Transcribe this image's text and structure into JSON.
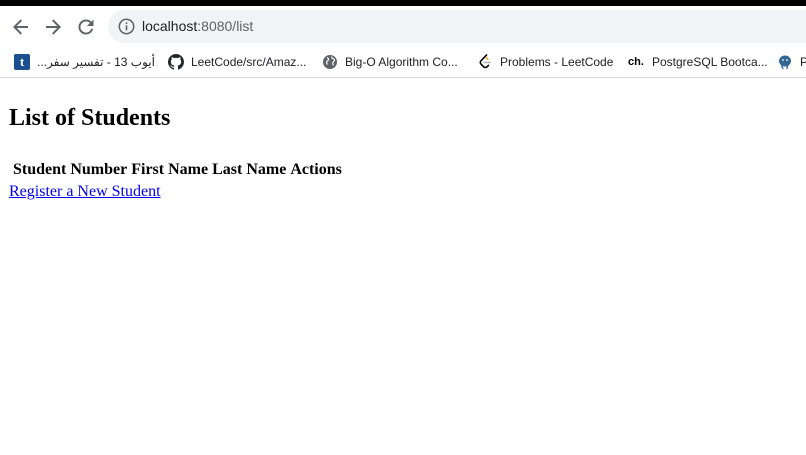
{
  "browser": {
    "url_host": "localhost",
    "url_path": ":8080/list",
    "bookmarks": [
      {
        "label": "أيوب 13 - تفسير سفر...",
        "icon": "t-favicon"
      },
      {
        "label": "LeetCode/src/Amaz...",
        "icon": "github-icon"
      },
      {
        "label": "Big-O Algorithm Co...",
        "icon": "globe-icon"
      },
      {
        "label": "Problems - LeetCode",
        "icon": "leetcode-icon"
      },
      {
        "label": "PostgreSQL Bootca...",
        "icon": "ch-favicon"
      },
      {
        "label": "P",
        "icon": "postgresql-icon"
      }
    ]
  },
  "page": {
    "title": "List of Students",
    "table": {
      "headers": [
        "Student Number",
        "First Name",
        "Last Name",
        "Actions"
      ]
    },
    "register_link": "Register a New Student"
  }
}
